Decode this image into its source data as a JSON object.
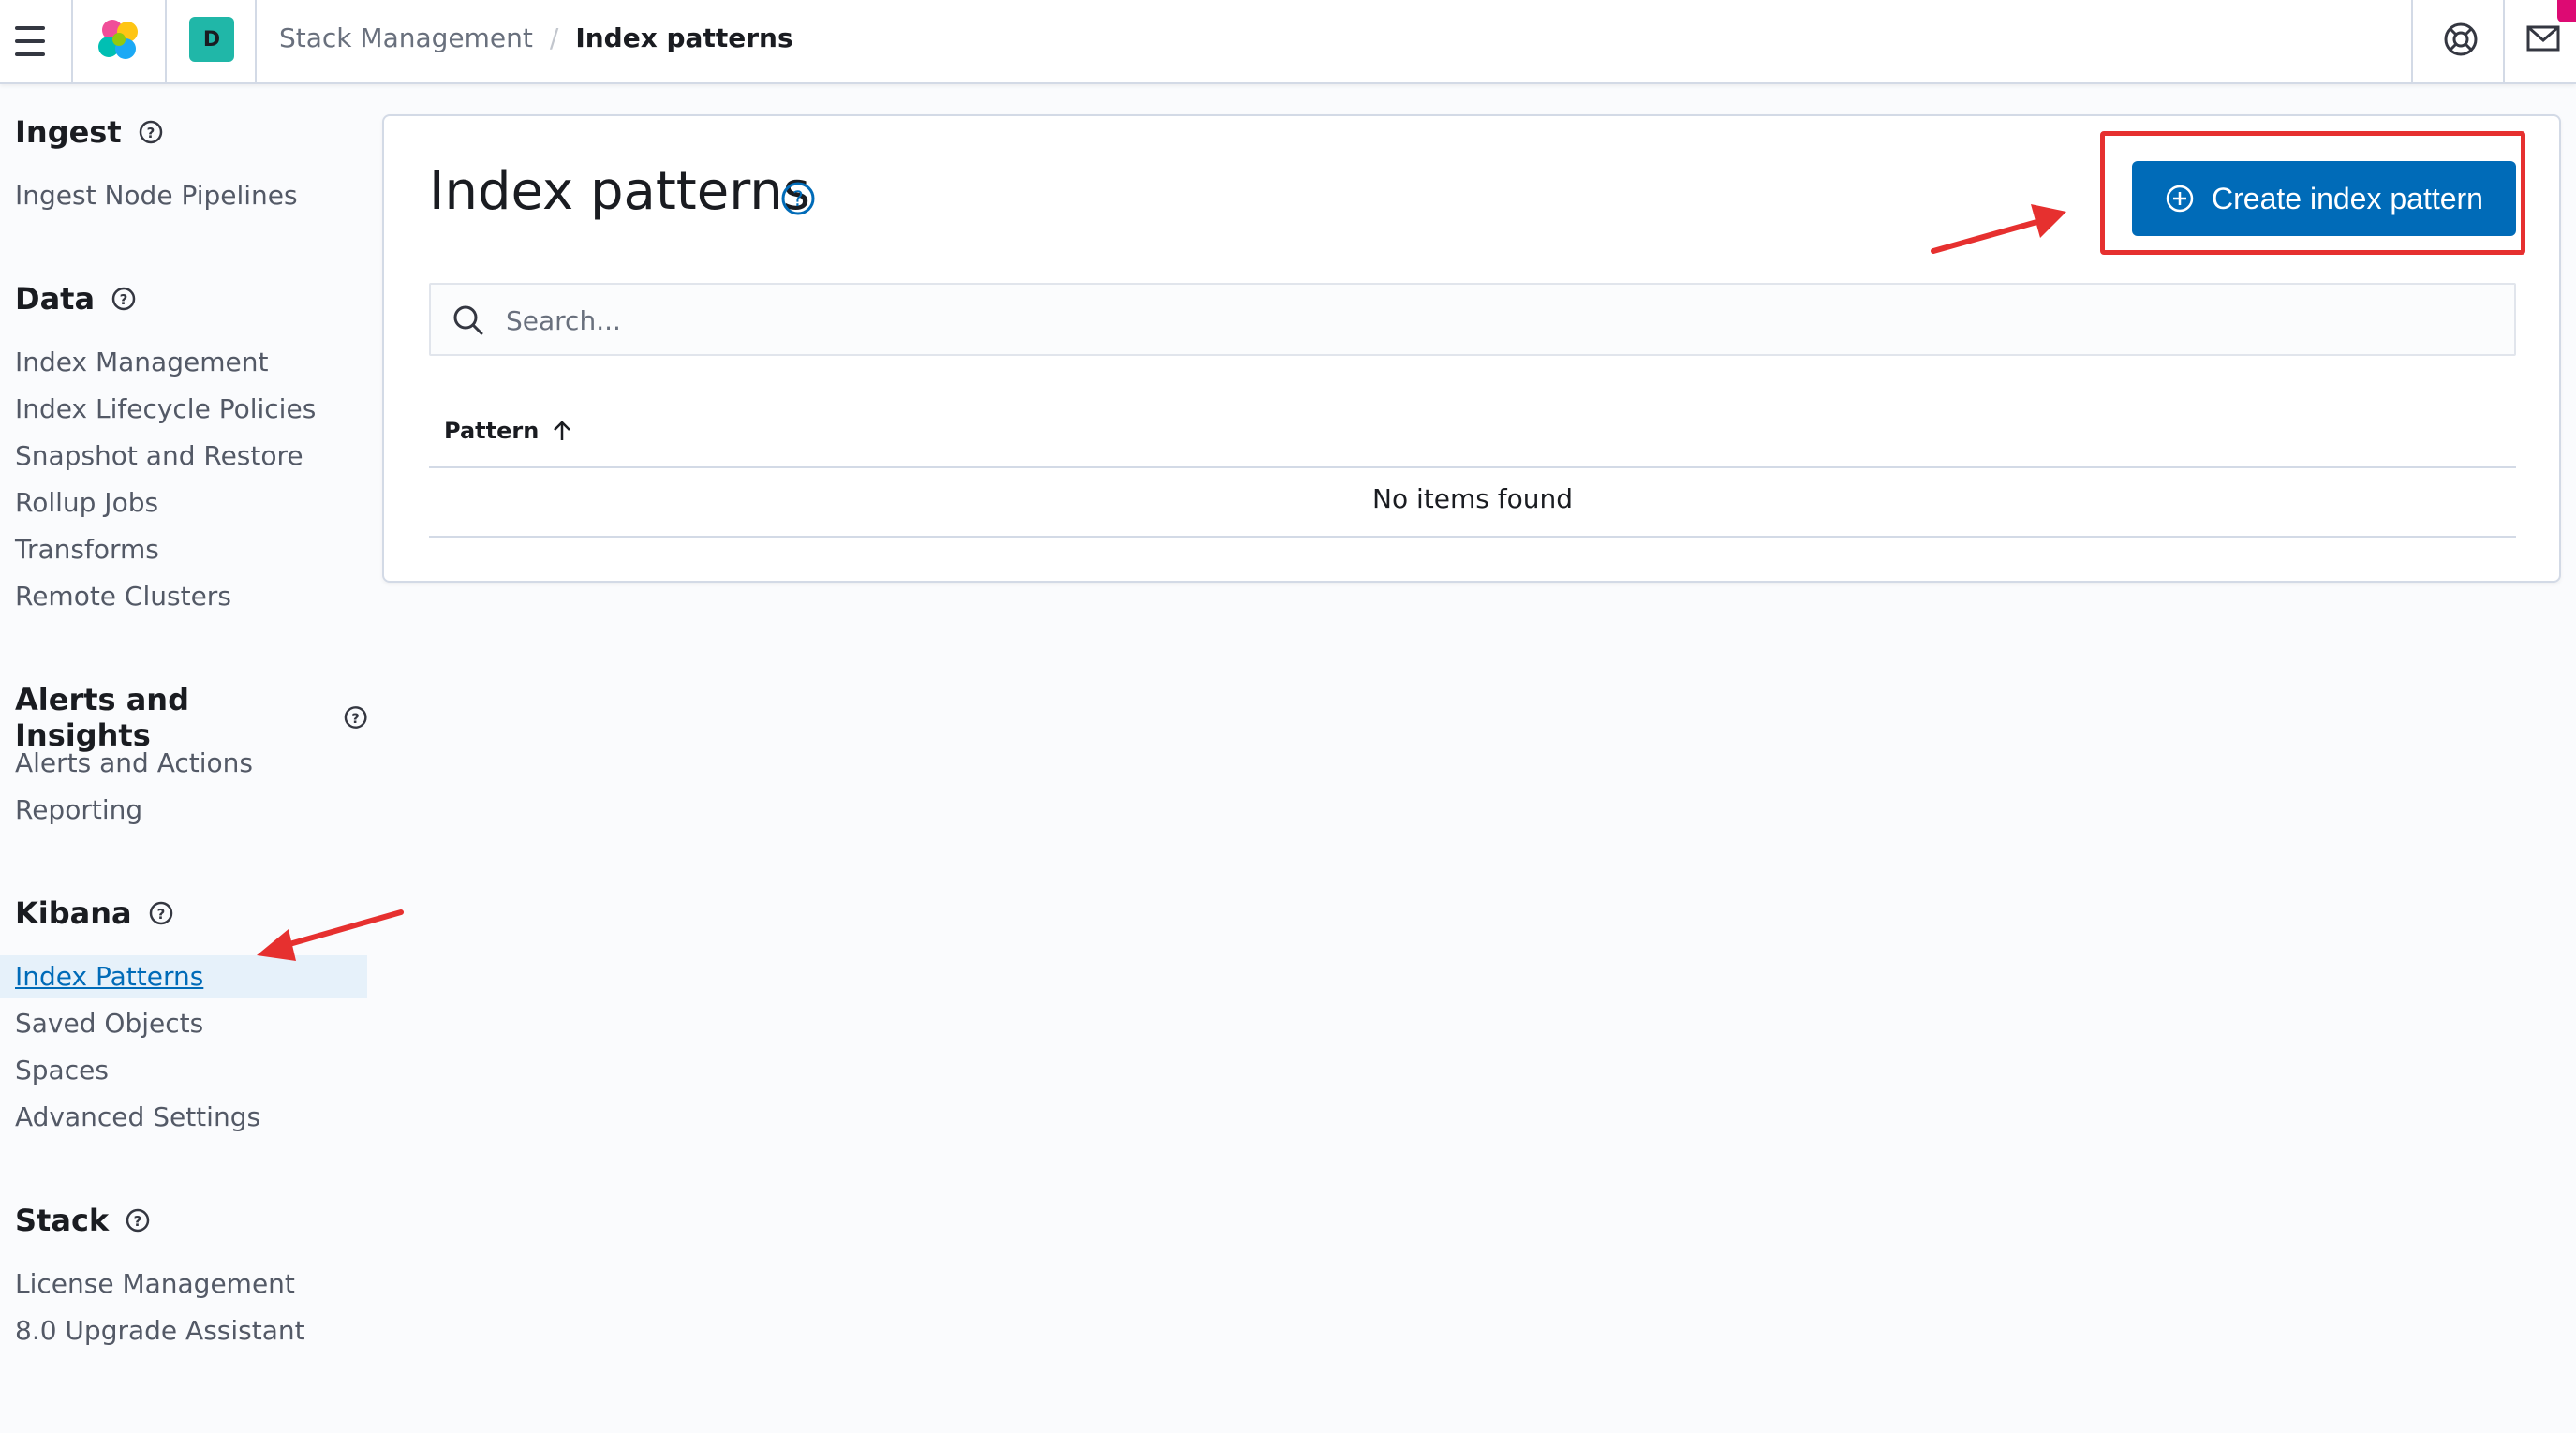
{
  "header": {
    "space_initial": "D",
    "breadcrumbs": [
      "Stack Management",
      "Index patterns"
    ]
  },
  "sidebar": {
    "sections": [
      {
        "title": "Ingest",
        "items": [
          "Ingest Node Pipelines"
        ]
      },
      {
        "title": "Data",
        "items": [
          "Index Management",
          "Index Lifecycle Policies",
          "Snapshot and Restore",
          "Rollup Jobs",
          "Transforms",
          "Remote Clusters"
        ]
      },
      {
        "title": "Alerts and Insights",
        "items": [
          "Alerts and Actions",
          "Reporting"
        ]
      },
      {
        "title": "Kibana",
        "items": [
          "Index Patterns",
          "Saved Objects",
          "Spaces",
          "Advanced Settings"
        ]
      },
      {
        "title": "Stack",
        "items": [
          "License Management",
          "8.0 Upgrade Assistant"
        ]
      }
    ],
    "active_item": "Index Patterns"
  },
  "main": {
    "title": "Index patterns",
    "create_button": "Create index pattern",
    "search_placeholder": "Search...",
    "table": {
      "column": "Pattern",
      "sort": "ascending",
      "empty_message": "No items found"
    }
  },
  "colors": {
    "primary": "#006bb8",
    "annotation_red": "#e6302f",
    "active_bg": "#e6f1fa"
  }
}
